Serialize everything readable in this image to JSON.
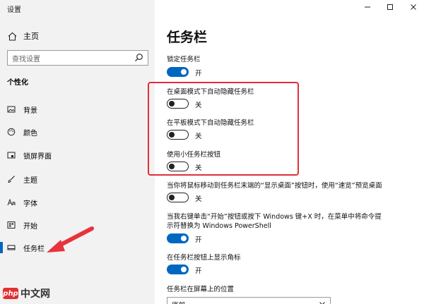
{
  "window": {
    "title": "设置"
  },
  "sidebar": {
    "home_label": "主页",
    "search_placeholder": "查找设置",
    "section_title": "个性化",
    "items": [
      {
        "label": "背景",
        "icon": "picture-icon"
      },
      {
        "label": "颜色",
        "icon": "palette-icon"
      },
      {
        "label": "锁屏界面",
        "icon": "lock-screen-icon"
      },
      {
        "label": "主题",
        "icon": "brush-icon"
      },
      {
        "label": "字体",
        "icon": "font-icon"
      },
      {
        "label": "开始",
        "icon": "start-icon"
      },
      {
        "label": "任务栏",
        "icon": "taskbar-icon",
        "selected": true
      }
    ]
  },
  "main": {
    "title": "任务栏",
    "settings": [
      {
        "label": "锁定任务栏",
        "state": "开",
        "on": true
      },
      {
        "label": "在桌面模式下自动隐藏任务栏",
        "state": "关",
        "on": false
      },
      {
        "label": "在平板模式下自动隐藏任务栏",
        "state": "关",
        "on": false
      },
      {
        "label": "使用小任务栏按钮",
        "state": "关",
        "on": false
      },
      {
        "label": "当你将鼠标移动到任务栏末端的“显示桌面”按钮时，使用“速览”预览桌面",
        "state": "关",
        "on": false
      },
      {
        "label_line1": "当我右键单击“开始”按钮或按下 Windows 键+X 时，在菜单中将命令提",
        "label_line2": "示符替换为 Windows PowerShell",
        "state": "开",
        "on": true
      },
      {
        "label": "在任务栏按钮上显示角标",
        "state": "开",
        "on": true
      }
    ],
    "position_label": "任务栏在屏幕上的位置",
    "position_value": "底部"
  },
  "watermark": {
    "logo_text": "php",
    "text": "中文网"
  },
  "colors": {
    "accent": "#0067c0",
    "highlight": "#e0303a",
    "arrow": "#e8323c"
  }
}
